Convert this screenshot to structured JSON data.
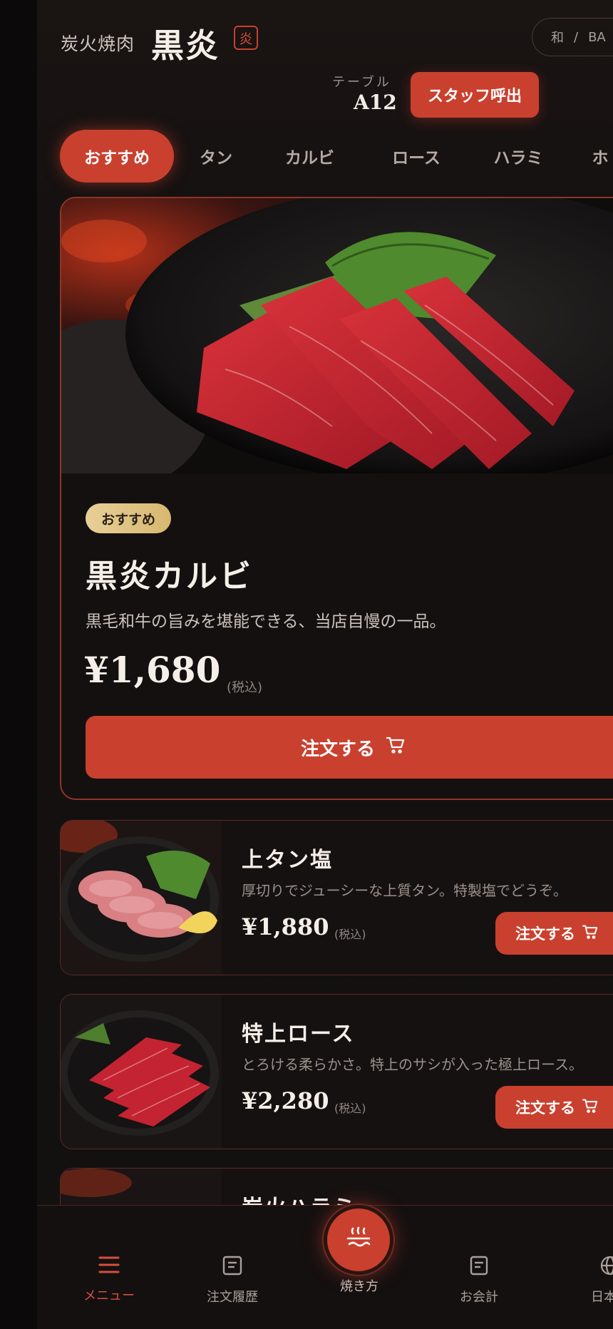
{
  "header": {
    "brand_sub": "炭火焼肉",
    "brand_name": "黒炎",
    "brand_seal": "炎",
    "lang_options": [
      "和",
      "/",
      "BA"
    ],
    "table_label": "テーブル",
    "table_number": "A12",
    "staff_call": "スタッフ呼出"
  },
  "categories": [
    {
      "label": "おすすめ",
      "active": true
    },
    {
      "label": "タン"
    },
    {
      "label": "カルビ"
    },
    {
      "label": "ロース"
    },
    {
      "label": "ハラミ"
    },
    {
      "label": "ホ"
    }
  ],
  "featured": {
    "badge": "おすすめ",
    "title": "黒炎カルビ",
    "description": "黒毛和牛の旨みを堪能できる、当店自慢の一品。",
    "price": "¥1,680",
    "tax": "(税込)",
    "order_label": "注文する"
  },
  "items": [
    {
      "title": "上タン塩",
      "description": "厚切りでジューシーな上質タン。特製塩でどうぞ。",
      "price": "¥1,880",
      "tax": "(税込)",
      "order_label": "注文する"
    },
    {
      "title": "特上ロース",
      "description": "とろける柔らかさ。特上のサシが入った極上ロース。",
      "price": "¥2,280",
      "tax": "(税込)",
      "order_label": "注文する"
    },
    {
      "title": "炭火ハラミ"
    }
  ],
  "bottom_nav": {
    "menu": "メニュー",
    "history": "注文履歴",
    "grill": "焼き方",
    "bill": "お会計",
    "language": "日本語"
  },
  "colors": {
    "accent": "#c9402e",
    "background": "#131010",
    "badge_gold": "#e0c382"
  }
}
